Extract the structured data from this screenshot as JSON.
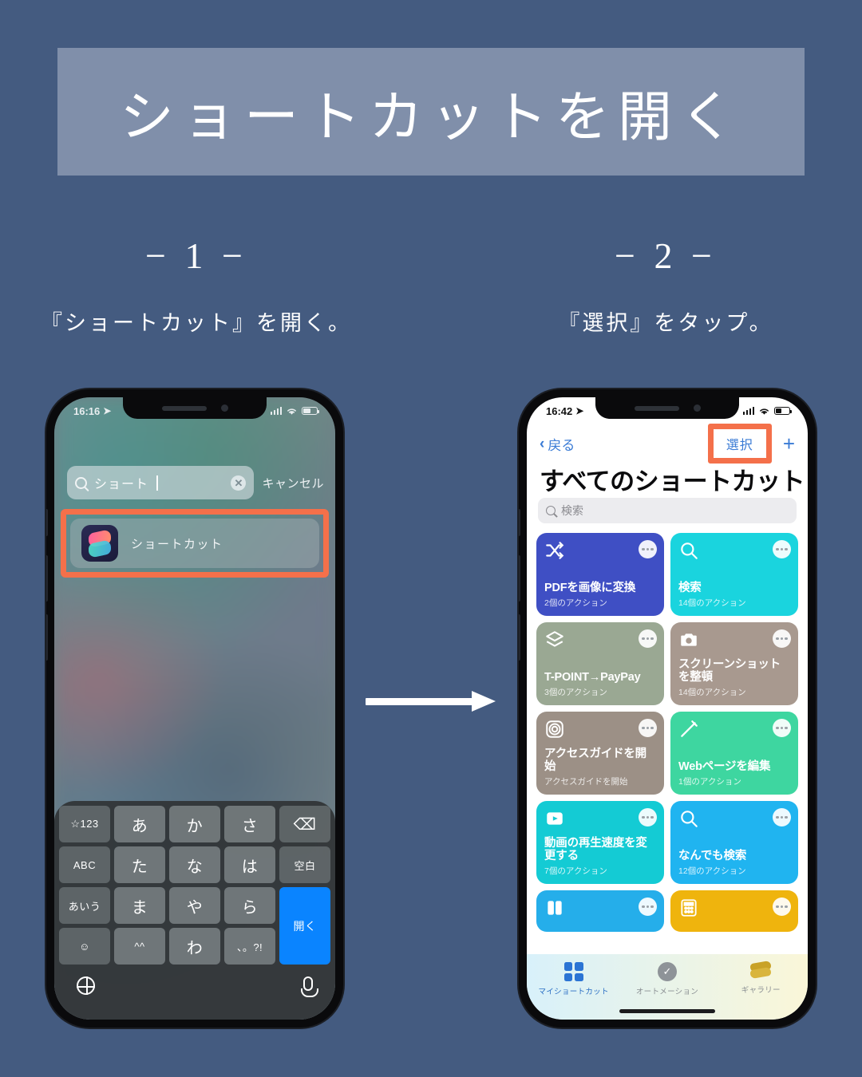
{
  "page": {
    "title": "ショートカットを開く",
    "background_color": "#445b80",
    "banner_color": "#99a6bc",
    "highlight_color": "#f4704a"
  },
  "steps": [
    {
      "number": "− 1 −",
      "caption": "『ショートカット』を開く。"
    },
    {
      "number": "− 2 −",
      "caption": "『選択』をタップ。"
    }
  ],
  "phone1": {
    "status": {
      "time": "16:16",
      "location_icon": "➤",
      "signal_icon": "signal-bars",
      "wifi_icon": "wifi",
      "battery_icon": "battery"
    },
    "search": {
      "value": "ショート",
      "icon": "search-icon",
      "clear_label": "✕",
      "cancel_label": "キャンセル"
    },
    "result": {
      "app_name": "ショートカット",
      "icon": "shortcuts-app-icon"
    },
    "keyboard": {
      "keys": [
        "☆123",
        "あ",
        "か",
        "さ",
        "⌫",
        "ABC",
        "た",
        "な",
        "は",
        "空白",
        "あいう",
        "ま",
        "や",
        "ら",
        "開く",
        "☺",
        "^^",
        "わ",
        "、。?!"
      ],
      "return_label": "開く",
      "globe_icon": "globe-icon",
      "mic_icon": "microphone-icon"
    }
  },
  "phone2": {
    "status": {
      "time": "16:42",
      "location_icon": "➤"
    },
    "nav": {
      "back_label": "戻る",
      "select_label": "選択",
      "add_label": "+"
    },
    "title": "すべてのショートカット",
    "search_placeholder": "検索",
    "tiles": [
      {
        "name": "PDFを画像に変換",
        "subtitle": "2個のアクション",
        "color": "#3f4fc4",
        "icon": "shuffle-icon"
      },
      {
        "name": "検索",
        "subtitle": "14個のアクション",
        "color": "#1ad4de",
        "icon": "search-icon"
      },
      {
        "name": "T-POINT→PayPay",
        "subtitle": "3個のアクション",
        "color": "#9aa893",
        "icon": "layers-icon"
      },
      {
        "name": "スクリーンショットを整頓",
        "subtitle": "14個のアクション",
        "color": "#a8998f",
        "icon": "camera-icon"
      },
      {
        "name": "アクセスガイドを開始",
        "subtitle": "アクセスガイドを開始",
        "color": "#9c9086",
        "icon": "guided-access-icon"
      },
      {
        "name": "Webページを編集",
        "subtitle": "1個のアクション",
        "color": "#3ed6a0",
        "icon": "pencil-icon"
      },
      {
        "name": "動画の再生速度を変更する",
        "subtitle": "7個のアクション",
        "color": "#14cbd4",
        "icon": "play-icon"
      },
      {
        "name": "なんでも検索",
        "subtitle": "12個のアクション",
        "color": "#20b4f0",
        "icon": "search-icon"
      }
    ],
    "partial_tiles": [
      {
        "color": "#25aeea",
        "icon": "book-icon"
      },
      {
        "color": "#efb40d",
        "icon": "calculator-icon"
      }
    ],
    "tabs": [
      {
        "label": "マイショートカット",
        "icon": "grid-icon",
        "active": true
      },
      {
        "label": "オートメーション",
        "icon": "clock-check-icon",
        "active": false
      },
      {
        "label": "ギャラリー",
        "icon": "layers-icon",
        "active": false
      }
    ]
  }
}
